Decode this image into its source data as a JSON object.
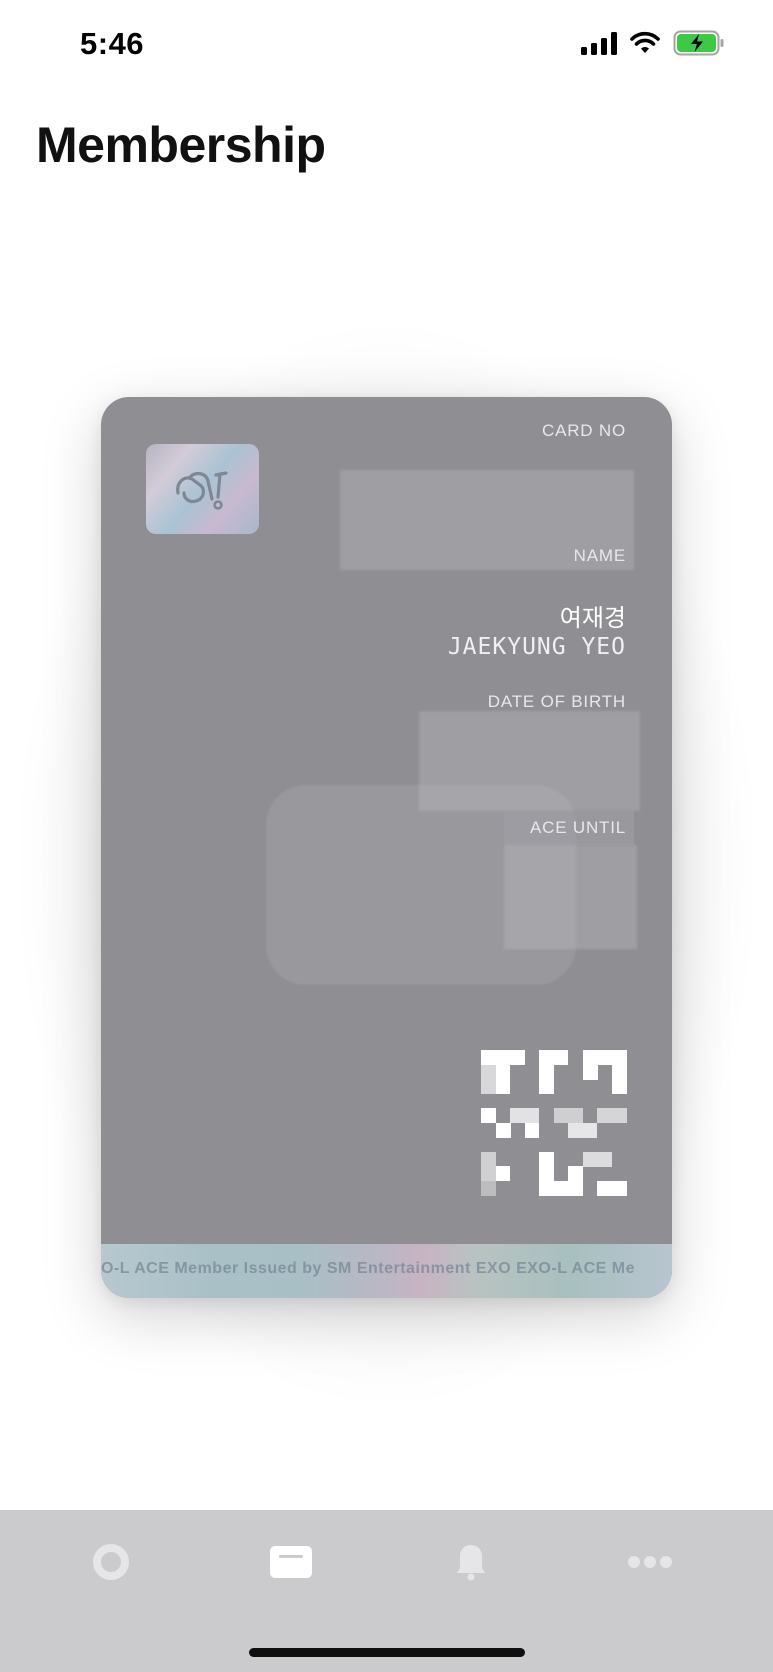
{
  "status_bar": {
    "time": "5:46",
    "icons": [
      "signal-icon",
      "wifi-icon",
      "battery-charging-icon"
    ],
    "battery_color": "#3dc945"
  },
  "header": {
    "title": "Membership"
  },
  "card": {
    "background_color": "#8e8e93",
    "logo_icon": "sm-logo-icon",
    "card_no_label": "CARD NO",
    "name_label": "NAME",
    "name_korean": "여재경",
    "name_english": "JAEKYUNG YEO",
    "dob_label": "DATE OF BIRTH",
    "ace_until_label": "ACE UNTIL",
    "ribbon_text": "O-L ACE Member Issued by SM Entertainment EXO EXO-L ACE Me"
  },
  "tab_bar": {
    "background_color": "#cbcbce",
    "tabs": [
      {
        "icon": "circle-icon",
        "active": false
      },
      {
        "icon": "card-icon",
        "active": true
      },
      {
        "icon": "bell-icon",
        "active": false
      },
      {
        "icon": "more-icon",
        "active": false
      }
    ]
  }
}
